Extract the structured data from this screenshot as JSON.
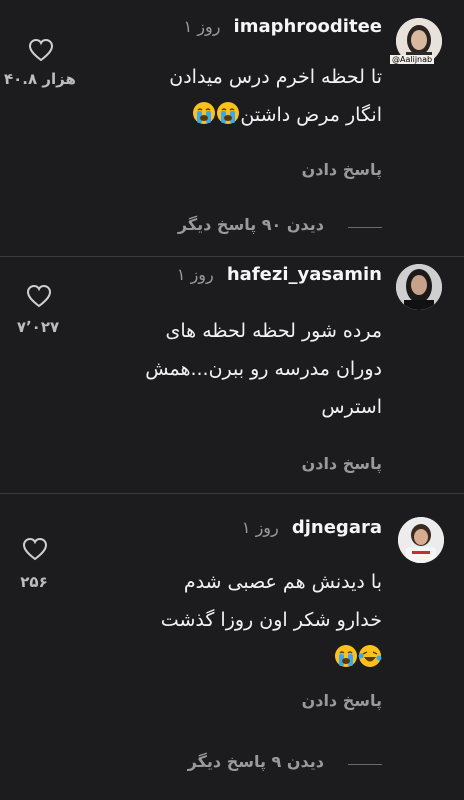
{
  "comments": [
    {
      "username": "imaphrooditee",
      "time": "۱ روز",
      "avatar_tag": "@Aalijnab",
      "likes": "۴۰.۸ هزار",
      "lines": [
        "تا لحظه اخرم درس میدادن",
        "انگار مرض داشتن"
      ],
      "emojis": [
        "crying-face-emoji",
        "crying-face-emoji"
      ],
      "reply": "پاسخ دادن",
      "more_replies": "دیدن ۹۰ پاسخ دیگر"
    },
    {
      "username": "hafezi_yasamin",
      "time": "۱ روز",
      "likes": "۷٬۰۲۷",
      "lines": [
        "مرده شور لحظه لحظه های",
        "دوران مدرسه رو ببرن...همش",
        "استرس"
      ],
      "reply": "پاسخ دادن"
    },
    {
      "username": "djnegara",
      "time": "۱ روز",
      "likes": "۲۵۶",
      "lines": [
        "با دیدنش هم عصبی شدم",
        "خدارو شکر اون روزا گذشت"
      ],
      "emojis": [
        "rolling-laughing-emoji",
        "crying-face-emoji"
      ],
      "reply": "پاسخ دادن",
      "more_replies": "دیدن ۹ پاسخ دیگر"
    }
  ]
}
